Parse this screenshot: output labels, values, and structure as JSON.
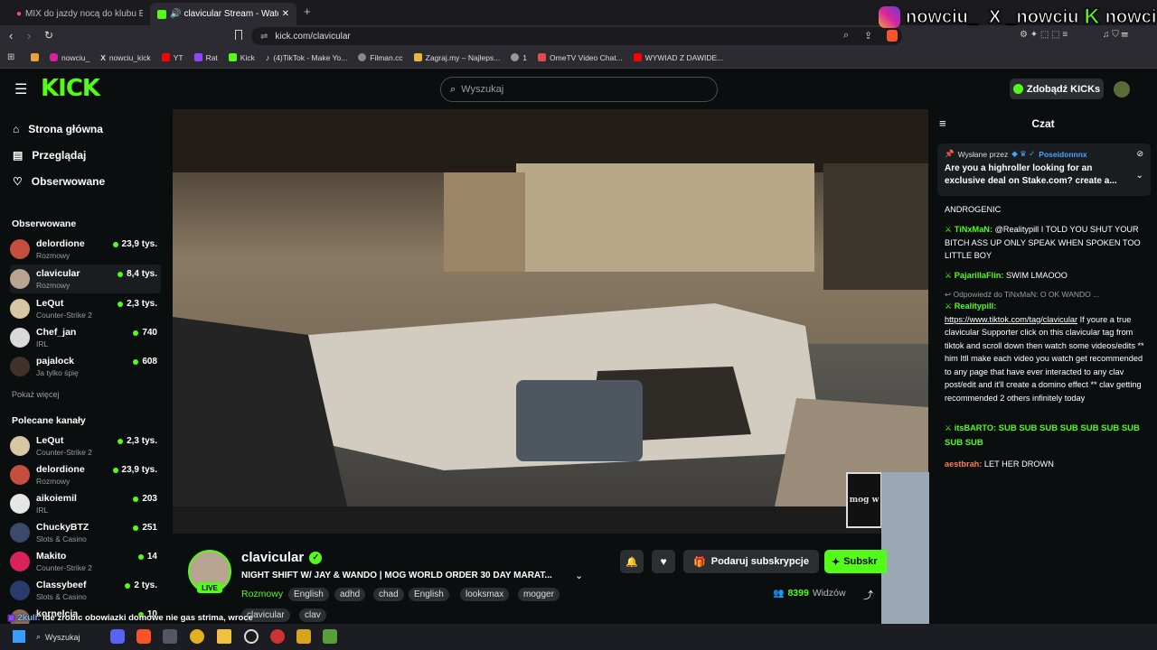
{
  "browser": {
    "tabs": [
      {
        "label": "MIX do jazdy nocą do klubu E",
        "active": false
      },
      {
        "label": "clavicular Stream - Watch Live",
        "active": true
      }
    ],
    "url": "kick.com/clavicular",
    "bookmarks": [
      "nowciu_",
      "nowciu_kick",
      "YT",
      "Rat",
      "Kick",
      "(4)TikTok - Make Yo...",
      "Filman.cc",
      "Zagraj.my – Najleps...",
      "1",
      "OmeTV Video Chat...",
      "WYWIAD Z DAWIDE..."
    ]
  },
  "overlay": {
    "handles": [
      "nowciu_",
      "_nowciu",
      "nowciu"
    ],
    "bottom_text": "ide zrobic obowiazki domowe nie gas strima, wroce",
    "bottom_user": "2kuli:"
  },
  "header": {
    "search_placeholder": "Wyszukaj",
    "kicks_button": "Zdobądź KICKs"
  },
  "sidebar": {
    "nav": [
      "Strona główna",
      "Przeglądaj",
      "Obserwowane"
    ],
    "followed_title": "Obserwowane",
    "followed": [
      {
        "name": "delordione",
        "category": "Rozmowy",
        "viewers": "23,9 tys."
      },
      {
        "name": "clavicular",
        "category": "Rozmowy",
        "viewers": "8,4 tys."
      },
      {
        "name": "LeQut",
        "category": "Counter-Strike 2",
        "viewers": "2,3 tys."
      },
      {
        "name": "Chef_jan",
        "category": "IRL",
        "viewers": "740"
      },
      {
        "name": "pajalock",
        "category": "Ja tylko śpię",
        "viewers": "608"
      }
    ],
    "show_more": "Pokaż więcej",
    "recommended_title": "Polecane kanały",
    "recommended": [
      {
        "name": "LeQut",
        "category": "Counter-Strike 2",
        "viewers": "2,3 tys."
      },
      {
        "name": "delordione",
        "category": "Rozmowy",
        "viewers": "23,9 tys."
      },
      {
        "name": "aikoiemil",
        "category": "IRL",
        "viewers": "203"
      },
      {
        "name": "ChuckyBTZ",
        "category": "Slots & Casino",
        "viewers": "251"
      },
      {
        "name": "Makito",
        "category": "Counter-Strike 2",
        "viewers": "14"
      },
      {
        "name": "Classybeef",
        "category": "Slots & Casino",
        "viewers": "2 tys."
      },
      {
        "name": "kornelcia",
        "category": "",
        "viewers": "10"
      }
    ]
  },
  "stream": {
    "channel": "clavicular",
    "live": "LIVE",
    "title": "NIGHT SHIFT W/ JAY & WANDO | MOG WORLD ORDER 30 DAY MARAT...",
    "category": "Rozmowy",
    "tags": [
      "English",
      "adhd",
      "chad",
      "English",
      "looksmax",
      "mogger",
      "clavicular",
      "clav"
    ],
    "gift_button": "Podaruj subskrypcje",
    "subscribe_button": "Subskr",
    "viewers": "8399",
    "viewers_label": "Widzów",
    "overlay_logo": "mog w"
  },
  "chat": {
    "title": "Czat",
    "pinned_by_label": "Wysłane przez",
    "pinned_by_user": "Poseidonnnx",
    "pinned_text": "Are you a highroller looking for an exclusive deal on Stake.com? create a...",
    "messages": [
      {
        "user": "",
        "text": "ANDROGENIC",
        "color": "#ffffff"
      },
      {
        "user": "TiNxMaN:",
        "text": "@Realitypill I TOLD YOU SHUT YOUR BITCH ASS UP ONLY SPEAK WHEN SPOKEN TOO LITTLE BOY",
        "color": "#53fc18"
      },
      {
        "user": "PajarillaFlin:",
        "text": "SWIM LMAOOO",
        "color": "#53fc18"
      },
      {
        "user": "Realitypill:",
        "reply": "Odpowiedź do TiNxMaN:",
        "reply_text": "O OK WANDO ...",
        "link": "https://www.tiktok.com/tag/clavicular",
        "text": " If youre a true clavicular Supporter click on this clavicular tag from tiktok and scroll down then watch some videos/edits ** him Itll make each video you watch get recommended to any page that have ever interacted to any clav post/edit and it'll create a domino effect ** clav getting recommended 2 others infinitely today",
        "color": "#53fc18"
      },
      {
        "user": "itsBARTO:",
        "text": "SUB SUB SUB SUB SUB SUB SUB SUB SUB",
        "color": "#53fc18"
      },
      {
        "user": "aestbrah:",
        "text": "LET HER DROWN",
        "color": "#ff7a59"
      }
    ]
  },
  "taskbar": {
    "search": "Wyszukaj"
  }
}
